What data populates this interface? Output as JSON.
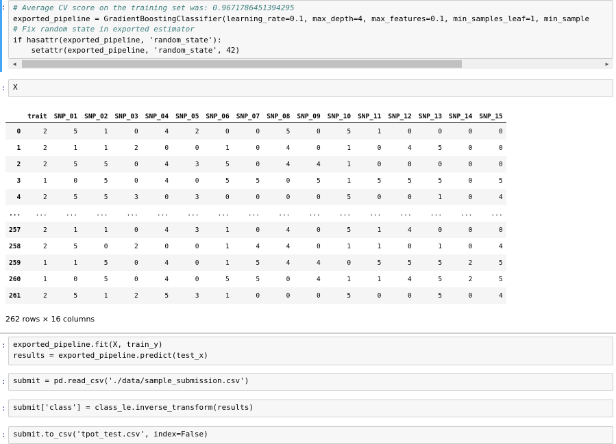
{
  "cells": {
    "cell1": {
      "lines": [
        "# Average CV score on the training set was: 0.9671786451394295",
        "exported_pipeline = GradientBoostingClassifier(learning_rate=0.1, max_depth=4, max_features=0.1, min_samples_leaf=1, min_sample",
        "# Fix random state in exported estimator",
        "if hasattr(exported_pipeline, 'random_state'):",
        "    setattr(exported_pipeline, 'random_state', 42)"
      ]
    },
    "cell2": {
      "code": "X"
    },
    "cell3": {
      "lines": [
        "exported_pipeline.fit(X, train_y)",
        "results = exported_pipeline.predict(test_x)"
      ]
    },
    "cell4": {
      "code": "submit = pd.read_csv('./data/sample_submission.csv')"
    },
    "cell5": {
      "code": "submit['class'] = class_le.inverse_transform(results)"
    },
    "cell6": {
      "code": "submit.to_csv('tpot_test.csv', index=False)"
    }
  },
  "prompt_symbol": ":",
  "dataframe": {
    "columns": [
      "",
      "trait",
      "SNP_01",
      "SNP_02",
      "SNP_03",
      "SNP_04",
      "SNP_05",
      "SNP_06",
      "SNP_07",
      "SNP_08",
      "SNP_09",
      "SNP_10",
      "SNP_11",
      "SNP_12",
      "SNP_13",
      "SNP_14",
      "SNP_15"
    ],
    "rows": [
      [
        "0",
        "2",
        "5",
        "1",
        "0",
        "4",
        "2",
        "0",
        "0",
        "5",
        "0",
        "5",
        "1",
        "0",
        "0",
        "0",
        "0"
      ],
      [
        "1",
        "2",
        "1",
        "1",
        "2",
        "0",
        "0",
        "1",
        "0",
        "4",
        "0",
        "1",
        "0",
        "4",
        "5",
        "0",
        "0"
      ],
      [
        "2",
        "2",
        "5",
        "5",
        "0",
        "4",
        "3",
        "5",
        "0",
        "4",
        "4",
        "1",
        "0",
        "0",
        "0",
        "0",
        "0"
      ],
      [
        "3",
        "1",
        "0",
        "5",
        "0",
        "4",
        "0",
        "5",
        "5",
        "0",
        "5",
        "1",
        "5",
        "5",
        "5",
        "0",
        "5"
      ],
      [
        "4",
        "2",
        "5",
        "5",
        "3",
        "0",
        "3",
        "0",
        "0",
        "0",
        "0",
        "5",
        "0",
        "0",
        "1",
        "0",
        "4"
      ],
      [
        "...",
        "...",
        "...",
        "...",
        "...",
        "...",
        "...",
        "...",
        "...",
        "...",
        "...",
        "...",
        "...",
        "...",
        "...",
        "...",
        "..."
      ],
      [
        "257",
        "2",
        "1",
        "1",
        "0",
        "4",
        "3",
        "1",
        "0",
        "4",
        "0",
        "5",
        "1",
        "4",
        "0",
        "0",
        "0"
      ],
      [
        "258",
        "2",
        "5",
        "0",
        "2",
        "0",
        "0",
        "1",
        "4",
        "4",
        "0",
        "1",
        "1",
        "0",
        "1",
        "0",
        "4"
      ],
      [
        "259",
        "1",
        "1",
        "5",
        "0",
        "4",
        "0",
        "1",
        "5",
        "4",
        "4",
        "0",
        "5",
        "5",
        "5",
        "2",
        "5"
      ],
      [
        "260",
        "1",
        "0",
        "5",
        "0",
        "4",
        "0",
        "5",
        "5",
        "0",
        "4",
        "1",
        "1",
        "4",
        "5",
        "2",
        "5"
      ],
      [
        "261",
        "2",
        "5",
        "1",
        "2",
        "5",
        "3",
        "1",
        "0",
        "0",
        "0",
        "5",
        "0",
        "0",
        "5",
        "0",
        "4"
      ]
    ],
    "shape_text": "262 rows × 16 columns"
  },
  "colors": {
    "active_cell": "#42a5f5",
    "prompt": "#303f9f"
  }
}
